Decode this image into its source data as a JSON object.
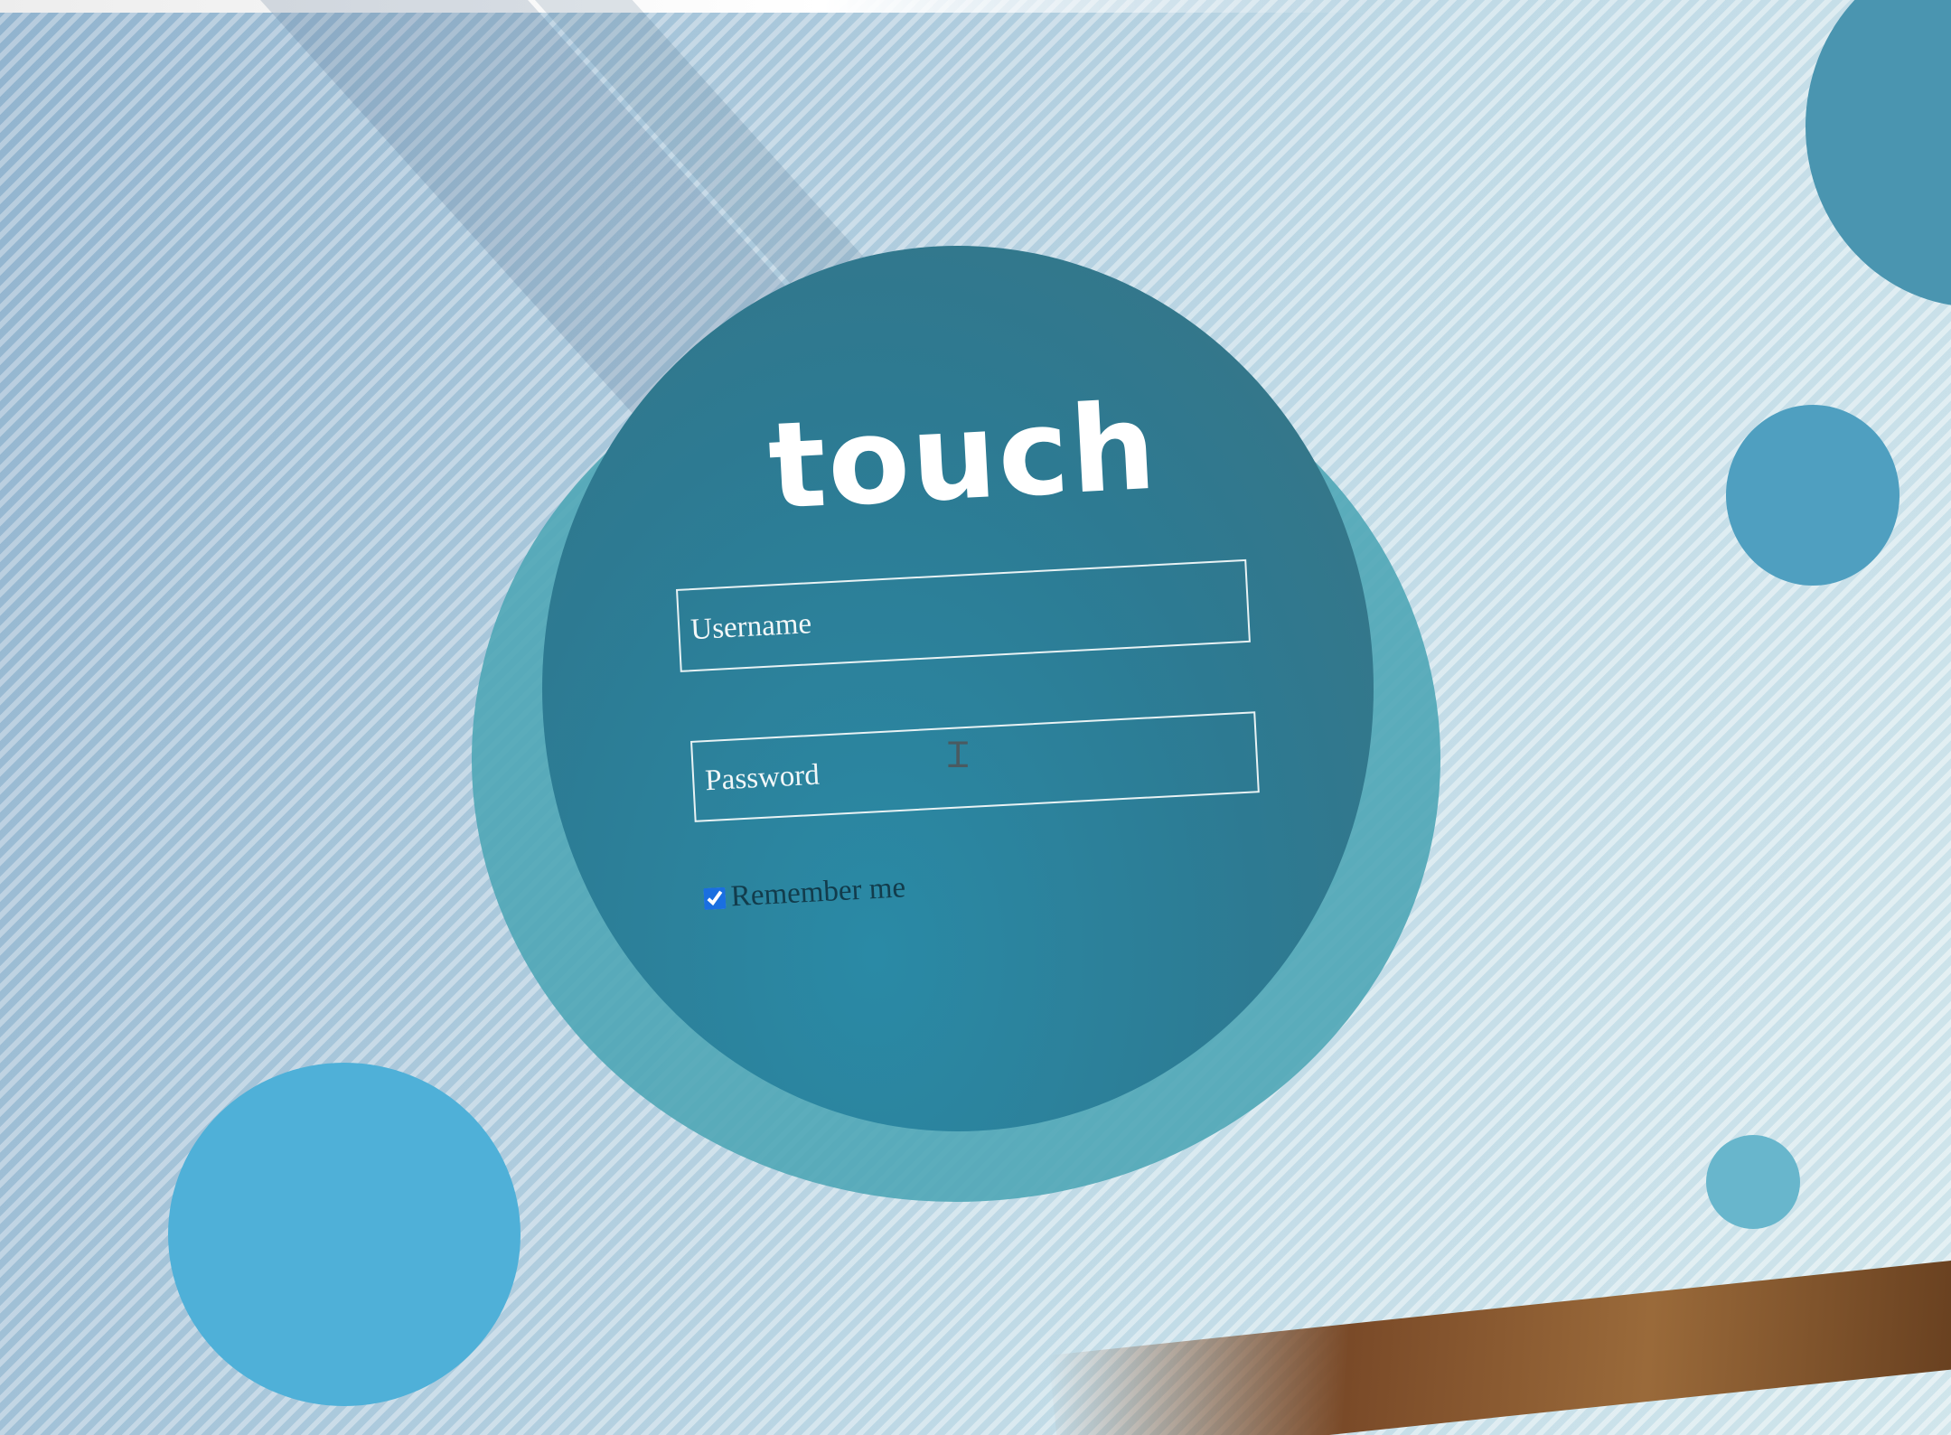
{
  "app": {
    "logo_text": "touch"
  },
  "login_form": {
    "username": {
      "value": "",
      "placeholder": "Username"
    },
    "password": {
      "value": "",
      "placeholder": "Password"
    },
    "remember_me": {
      "label": "Remember me",
      "checked": true
    }
  },
  "colors": {
    "primary_bubble": "#2d7a92",
    "secondary_bubble": "#4fa6b6",
    "accent_checkbox": "#1a6fe0",
    "text_light": "#ffffff"
  },
  "icons": {
    "cursor": "text-cursor-icon"
  }
}
